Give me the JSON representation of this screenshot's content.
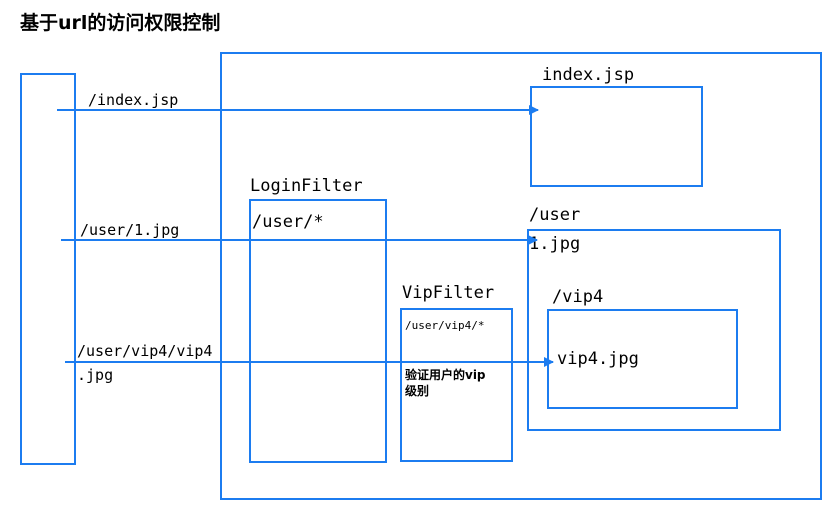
{
  "title": "基于url的访问权限控制",
  "labels": {
    "index_jsp": "index.jsp",
    "login_filter": "LoginFilter",
    "login_pattern": "/user/*",
    "user_dir": "/user",
    "user_file": "1.jpg",
    "vip_filter": "VipFilter",
    "vip_pattern": "/user/vip4/*",
    "vip_desc": "验证用户的vip级别",
    "vip4_dir": "/vip4",
    "vip4_file": "vip4.jpg"
  },
  "requests": [
    {
      "path": "/index.jsp"
    },
    {
      "path": "/user/1.jpg"
    },
    {
      "path_line1": "/user/vip4/vip4",
      "path_line2": ".jpg"
    }
  ],
  "colors": {
    "line": "#1c7cf0"
  }
}
